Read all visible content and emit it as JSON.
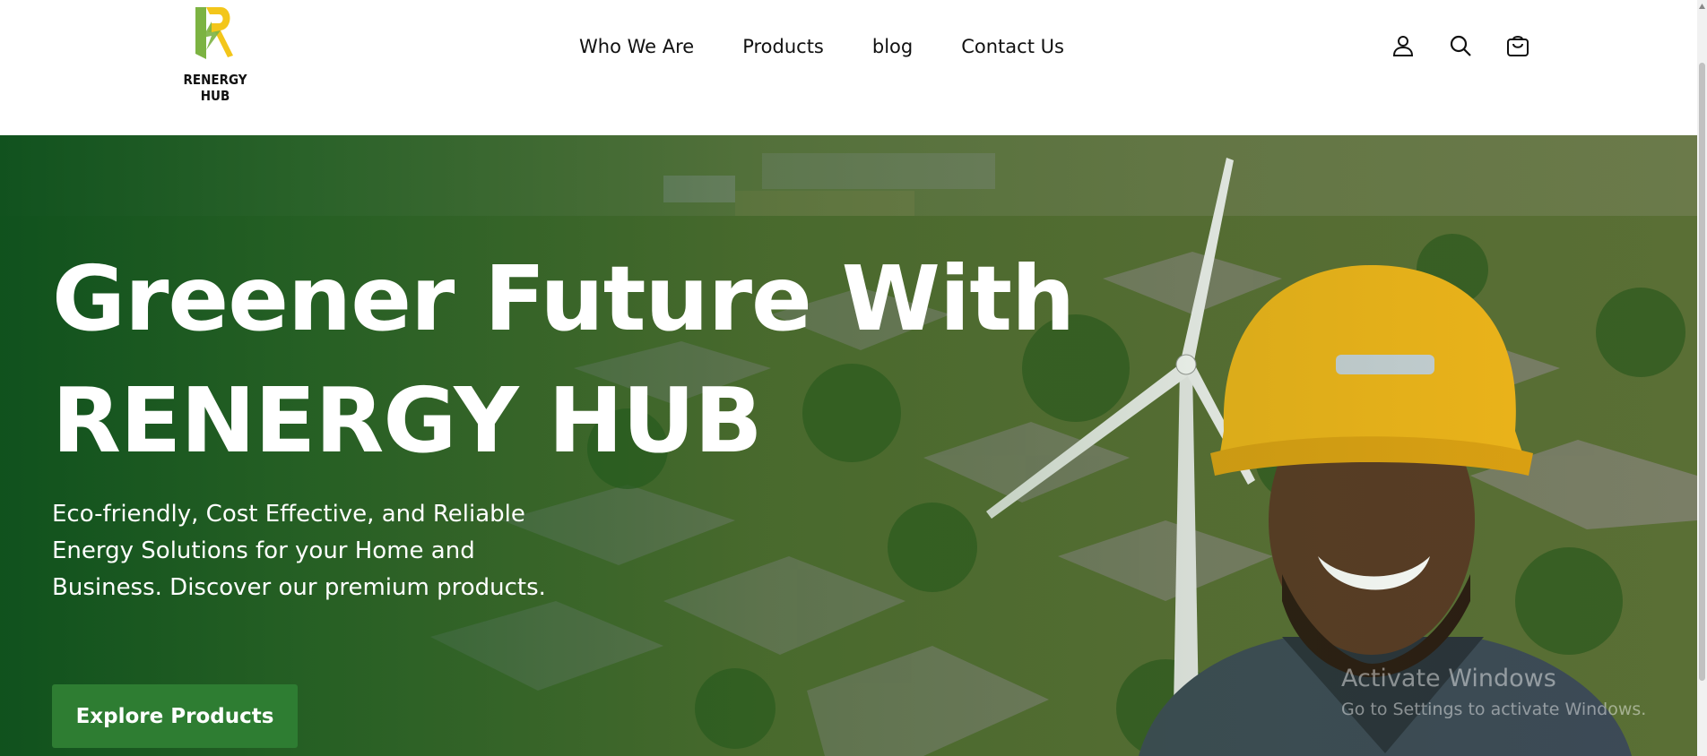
{
  "brand": {
    "name": "RENERGY HUB",
    "logo_colors": {
      "yellow": "#f3c61a",
      "green": "#7cb342"
    }
  },
  "nav": {
    "items": [
      {
        "label": "Who We Are"
      },
      {
        "label": "Products"
      },
      {
        "label": "blog"
      },
      {
        "label": "Contact Us"
      }
    ]
  },
  "header_icons": [
    "user-icon",
    "search-icon",
    "cart-icon"
  ],
  "hero": {
    "title_line1": "Greener Future With",
    "title_line2": "RENERGY HUB",
    "subtitle": "Eco-friendly, Cost Effective, and Reliable Energy Solutions for your Home and Business. Discover our premium products.",
    "cta_label": "Explore Products",
    "cta_color": "#2e7d32"
  },
  "os_watermark": {
    "title": "Activate Windows",
    "subtitle": "Go to Settings to activate Windows."
  }
}
